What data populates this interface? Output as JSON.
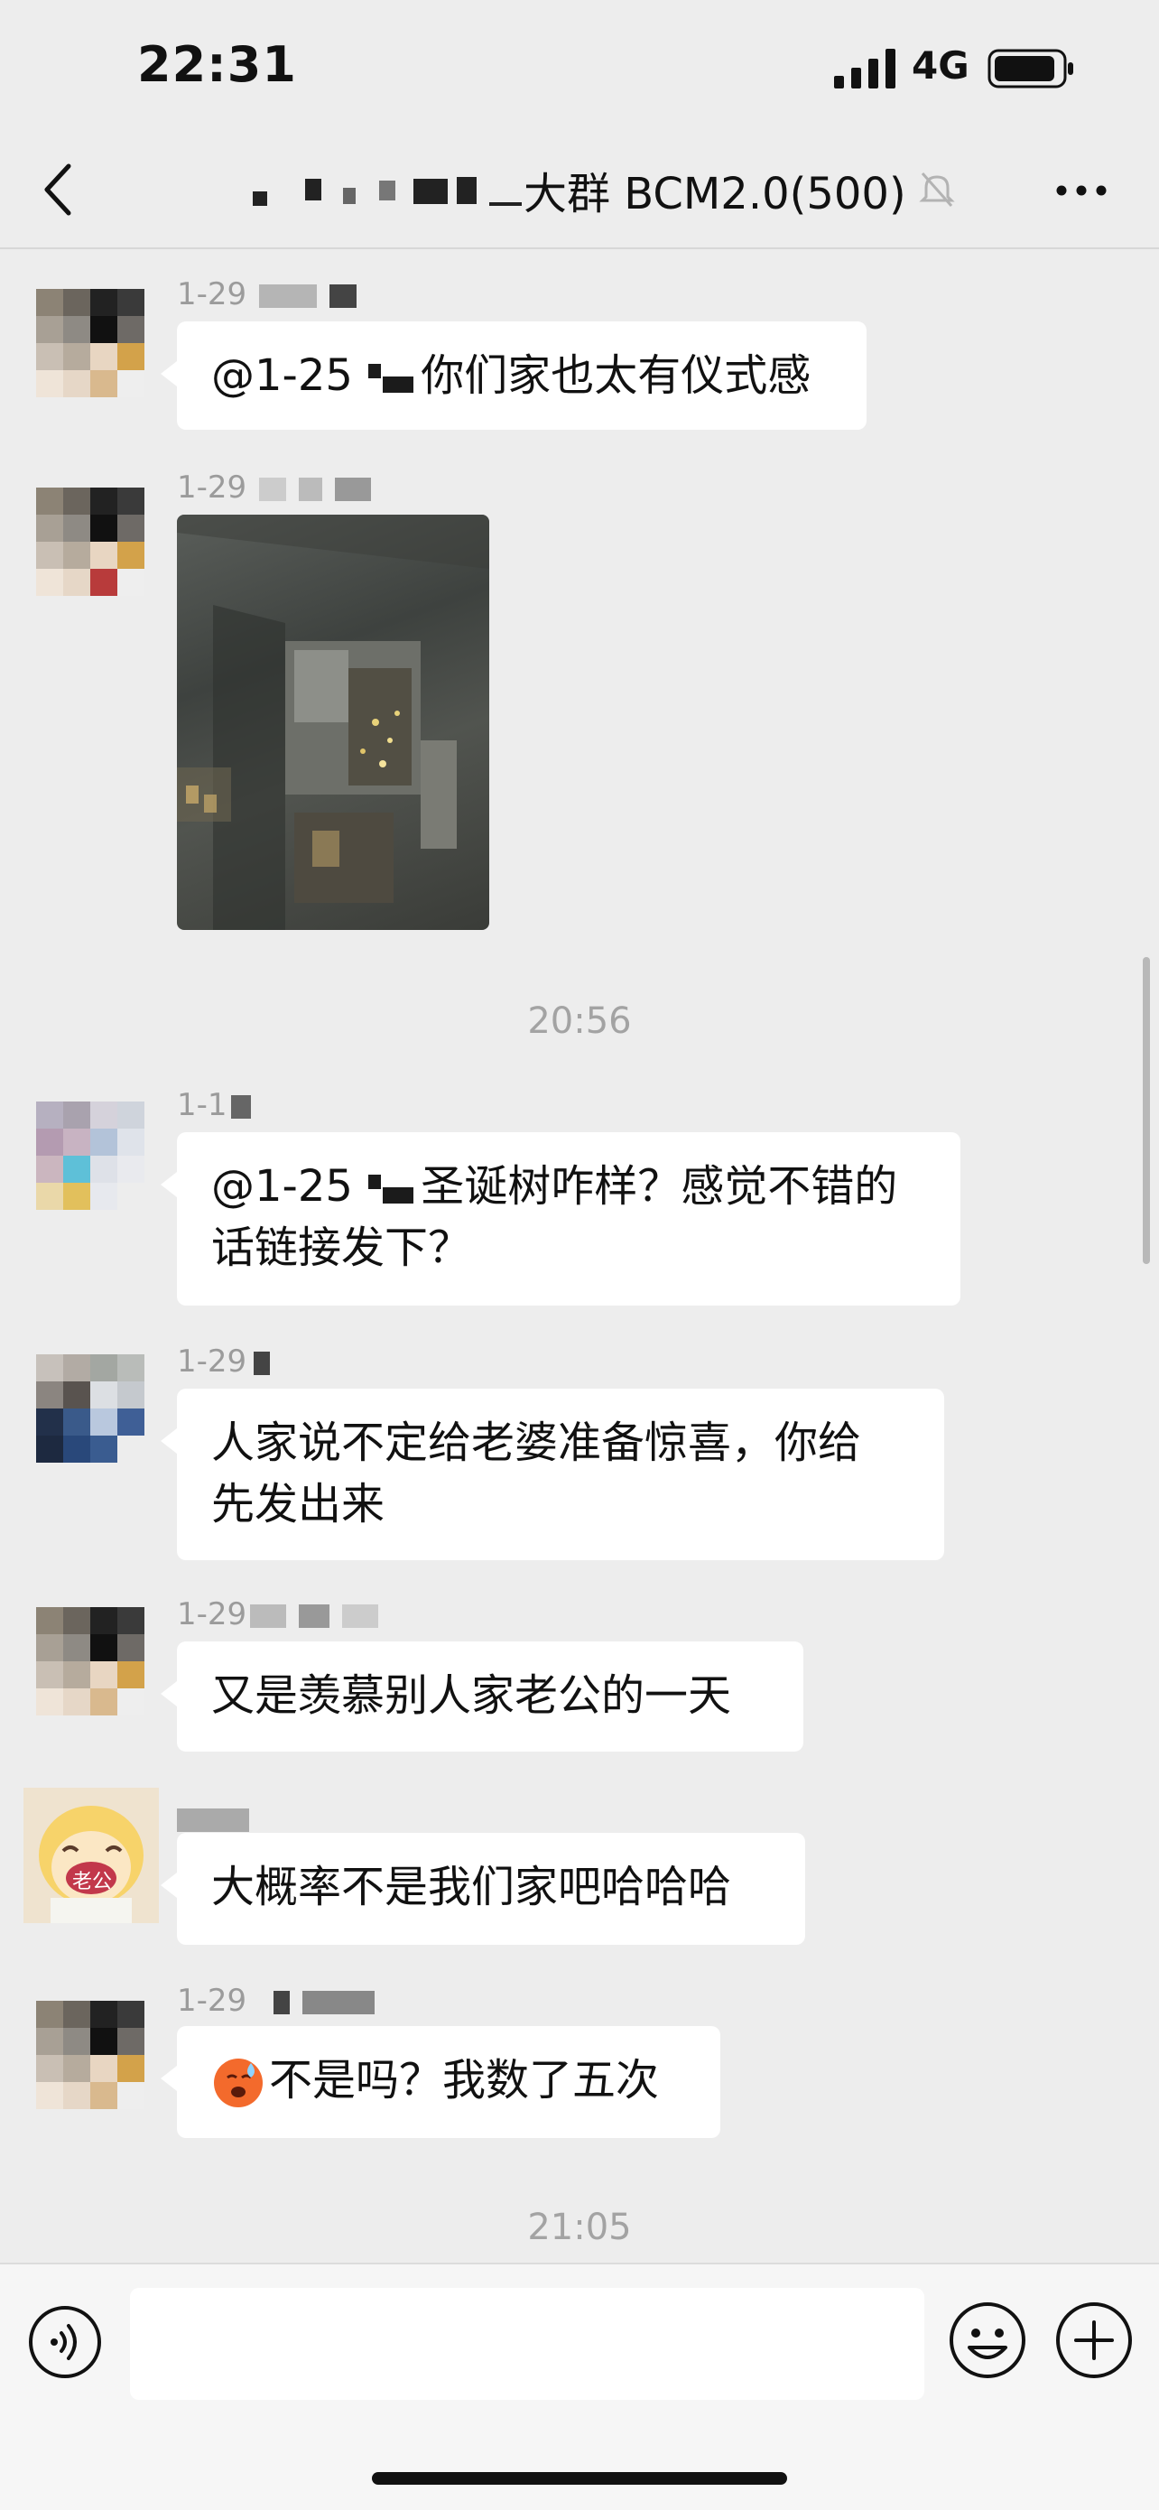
{
  "status_bar": {
    "time": "22:31",
    "network": "4G"
  },
  "nav": {
    "title": "大群 BCM2.0(500)"
  },
  "messages": [
    {
      "sender": "1-29",
      "text": "你们家也太有仪式感",
      "mention": "@1-25"
    },
    {
      "sender": "1-29"
    },
    {
      "sender": "1-1",
      "mention": "@1-25",
      "text": "圣诞树咋样？感觉不错的",
      "text2": "话链接发下？"
    },
    {
      "sender": "1-29",
      "text": "人家说不定给老婆准备惊喜，你给",
      "text2": "先发出来"
    },
    {
      "sender": "1-29",
      "text": "又是羡慕别人家老公的一天"
    },
    {
      "sender": "",
      "avatar_label": "老公",
      "text": "大概率不是我们家吧哈哈哈"
    },
    {
      "sender": "1-29",
      "text": "不是吗？我数了五次"
    }
  ],
  "time_separators": [
    "20:56",
    "21:05"
  ]
}
